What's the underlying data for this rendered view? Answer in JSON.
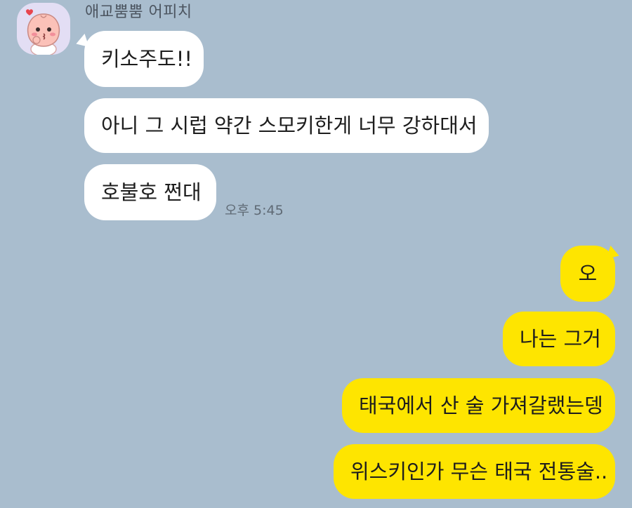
{
  "chat": {
    "incoming": {
      "sender_name": "애교뿜뿜 어피치",
      "avatar_icon": "apeach-character-icon",
      "messages": [
        {
          "text": "키소주도!!"
        },
        {
          "text": "아니 그 시럽 약간 스모키한게 너무 강하대서"
        },
        {
          "text": "호불호 쩐대"
        }
      ],
      "timestamp": "오후 5:45"
    },
    "outgoing": {
      "messages": [
        {
          "text": "오"
        },
        {
          "text": "나는 그거"
        },
        {
          "text": "태국에서 산 술 가져갈랬는뎅"
        },
        {
          "text": "위스키인가 무슨 태국 전통술.."
        }
      ]
    },
    "colors": {
      "background": "#a9bdce",
      "incoming_bubble": "#ffffff",
      "outgoing_bubble": "#fee500"
    }
  }
}
